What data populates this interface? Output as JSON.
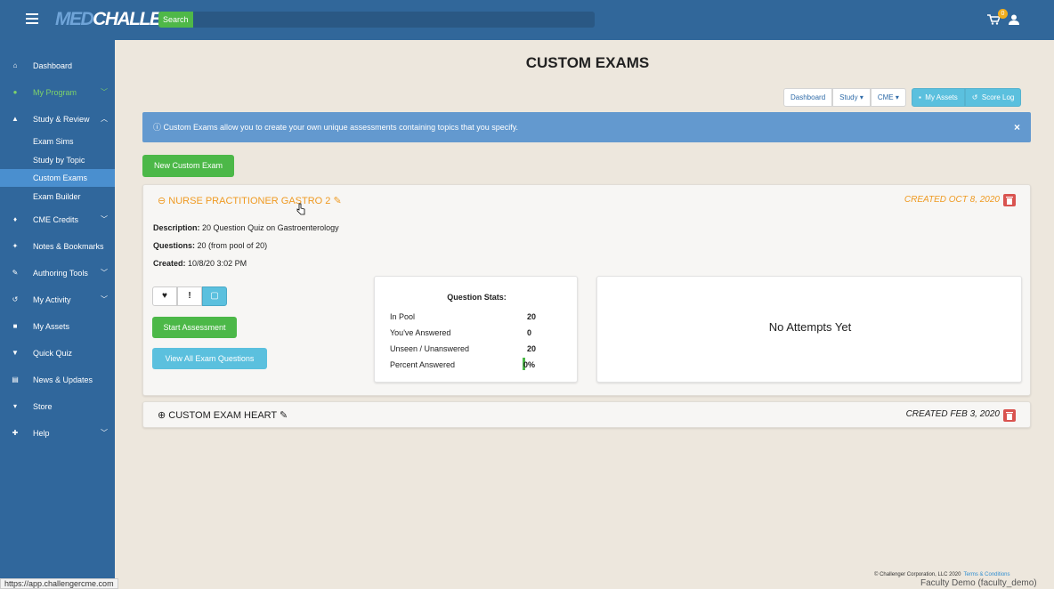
{
  "header": {
    "logo_med": "MED",
    "logo_challenger": "CHALLENGER",
    "search_label": "Search",
    "cart_count": "0"
  },
  "sidebar": {
    "items": [
      {
        "label": "Dashboard",
        "icon": "home-icon"
      },
      {
        "label": "My Program",
        "icon": "users-icon"
      },
      {
        "label": "Study & Review",
        "icon": "graduation-cap-icon"
      },
      {
        "label": "CME Credits",
        "icon": "bell-icon"
      },
      {
        "label": "Notes & Bookmarks",
        "icon": "pin-icon"
      },
      {
        "label": "Authoring Tools",
        "icon": "edit-icon"
      },
      {
        "label": "My Activity",
        "icon": "history-icon"
      },
      {
        "label": "My Assets",
        "icon": "book-icon"
      },
      {
        "label": "Quick Quiz",
        "icon": "trophy-icon"
      },
      {
        "label": "News & Updates",
        "icon": "newspaper-icon"
      },
      {
        "label": "Store",
        "icon": "cart-icon"
      },
      {
        "label": "Help",
        "icon": "ambulance-icon"
      }
    ],
    "sub_items": [
      "Exam Sims",
      "Study by Topic",
      "Custom Exams",
      "Exam Builder"
    ]
  },
  "main": {
    "title": "CUSTOM EXAMS",
    "nav_buttons": {
      "dashboard": "Dashboard",
      "study": "Study",
      "cme": "CME"
    },
    "asset_buttons": {
      "my_assets": "My Assets",
      "score_log": "Score Log"
    },
    "alert": "Custom Exams allow you to create your own unique assessments containing topics that you specify.",
    "alert_close": "×",
    "new_exam_button": "New Custom Exam"
  },
  "exams": [
    {
      "title": "NURSE PRACTITIONER GASTRO 2",
      "created": "CREATED OCT 8, 2020",
      "description_label": "Description:",
      "description": "20 Question Quiz on Gastroenterology",
      "questions_label": "Questions:",
      "questions": "20 (from pool of 20)",
      "created_label": "Created:",
      "created_at": "10/8/20 3:02 PM",
      "start_button": "Start Assessment",
      "view_button": "View All Exam Questions",
      "stats": {
        "title": "Question Stats:",
        "rows": [
          {
            "label": "In Pool",
            "value": "20"
          },
          {
            "label": "You've Answered",
            "value": "0"
          },
          {
            "label": "Unseen / Unanswered",
            "value": "20"
          },
          {
            "label": "Percent Answered",
            "value": "0%"
          }
        ],
        "percent_answered": 0
      },
      "attempts": "No Attempts Yet",
      "accent": "#ef9a22"
    },
    {
      "title": "CUSTOM EXAM HEART",
      "created": "CREATED FEB 3, 2020"
    }
  ],
  "footer": {
    "copyright": "© Challenger Corporation, LLC 2020",
    "terms": "Terms & Conditions",
    "user": "Faculty Demo (faculty_demo)",
    "status_url": "https://app.challengercme.com"
  },
  "colors": {
    "sidebar": "#30679c",
    "topbar": "#31679a",
    "green": "#4cb848",
    "info": "#5bc0de",
    "danger": "#d9534f",
    "orange": "#ef9a22"
  }
}
